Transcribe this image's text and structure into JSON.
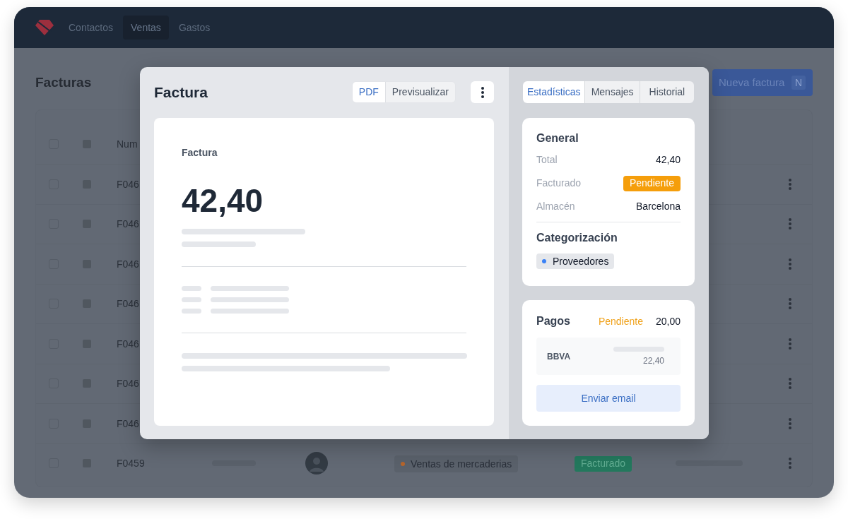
{
  "nav": {
    "items": [
      {
        "label": "Contactos",
        "selected": false
      },
      {
        "label": "Ventas",
        "selected": true
      },
      {
        "label": "Gastos",
        "selected": false
      }
    ]
  },
  "page": {
    "title": "Facturas",
    "new_button": {
      "label": "Nueva factura",
      "shortcut": "N"
    }
  },
  "table": {
    "header": {
      "checked": false,
      "column_3": "Num"
    },
    "rows": [
      {
        "checked": false,
        "column_3": "F046"
      },
      {
        "checked": false,
        "column_3": "F046"
      },
      {
        "checked": false,
        "column_3": "F046"
      },
      {
        "checked": false,
        "column_3": "F046"
      },
      {
        "checked": false,
        "column_3": "F046"
      },
      {
        "checked": false,
        "column_3": "F046"
      },
      {
        "checked": false,
        "column_3": "F046"
      },
      {
        "checked": false,
        "column_3": "F0459",
        "category": {
          "label": "Ventas de mercaderias",
          "color": "#b5652c"
        },
        "status": "Facturado"
      }
    ]
  },
  "invoice": {
    "title": "Factura",
    "view_tabs": [
      {
        "label": "PDF",
        "selected": true
      },
      {
        "label": "Previsualizar",
        "selected": false
      }
    ],
    "document": {
      "title": "Factura",
      "amount": "42,40"
    },
    "detail_tabs": [
      {
        "label": "Estadísticas",
        "selected": true
      },
      {
        "label": "Mensajes",
        "selected": false
      },
      {
        "label": "Historial",
        "selected": false
      }
    ],
    "general": {
      "title": "General",
      "rows": [
        {
          "kind": "text",
          "label": "Total",
          "value": "42,40"
        },
        {
          "kind": "badge",
          "label": "Facturado",
          "value": "Pendiente"
        },
        {
          "kind": "text",
          "label": "Almacén",
          "value": "Barcelona"
        }
      ]
    },
    "categorization": {
      "title": "Categorización",
      "tags": [
        {
          "label": "Proveedores",
          "color": "#3b82f6"
        }
      ]
    },
    "payments": {
      "title": "Pagos",
      "status": "Pendiente",
      "amount": "20,00",
      "entries": [
        {
          "bank": "BBVA",
          "amount": "22,40"
        }
      ],
      "action": "Enviar email"
    }
  }
}
